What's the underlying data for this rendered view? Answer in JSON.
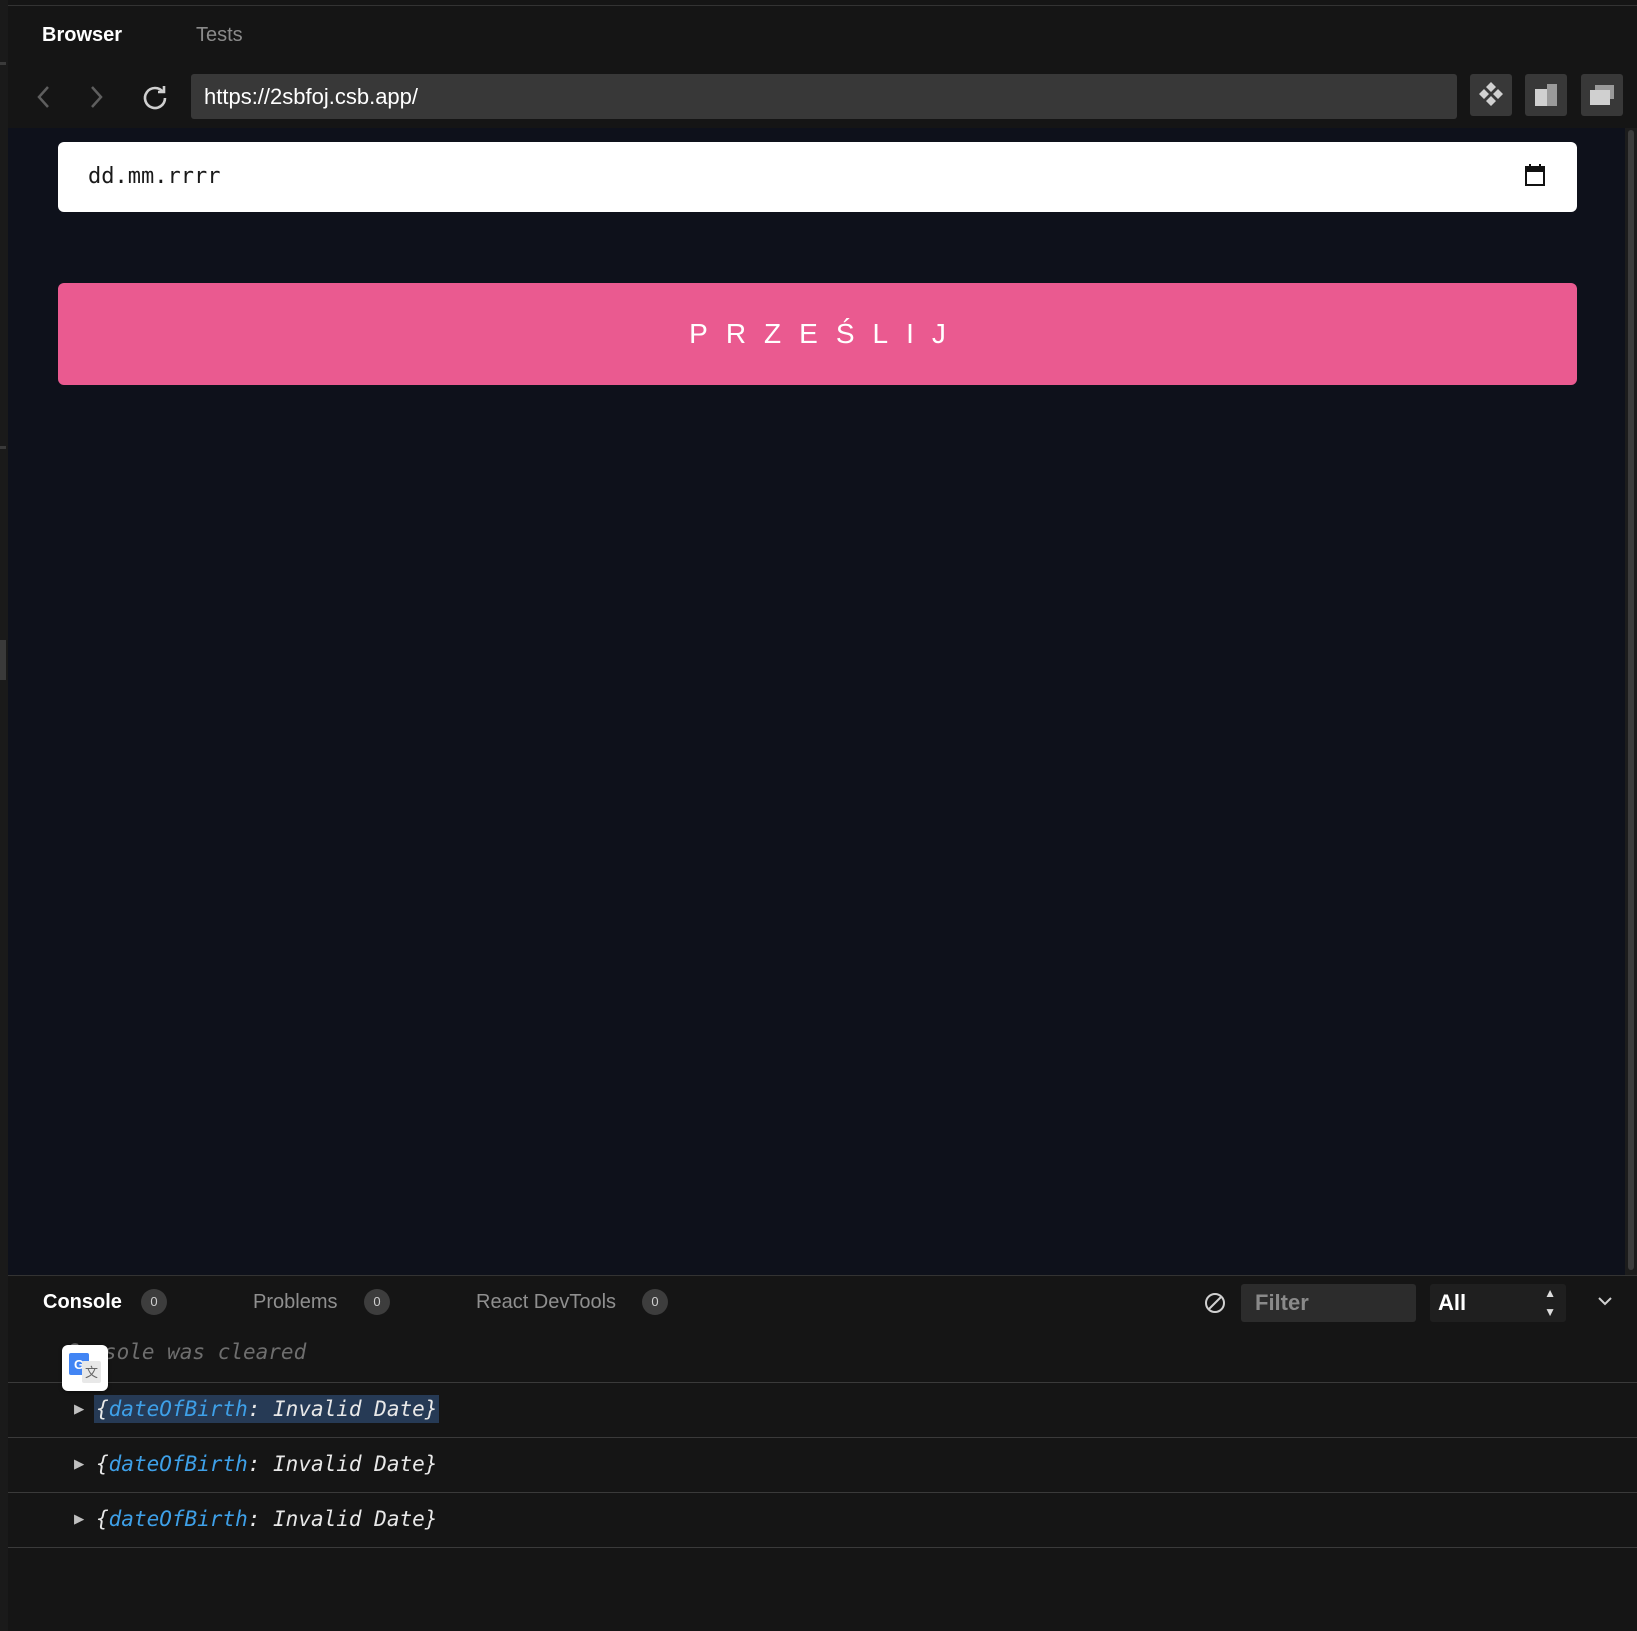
{
  "tabs": {
    "browser": "Browser",
    "tests": "Tests"
  },
  "navbar": {
    "url": "https://2sbfoj.csb.app/"
  },
  "form": {
    "date_value": "dd.mm.rrrr",
    "submit_label": "PRZEŚLIJ",
    "submit_color": "#ea5a90"
  },
  "console": {
    "tabs": [
      {
        "label": "Console",
        "count": "0"
      },
      {
        "label": "Problems",
        "count": "0"
      },
      {
        "label": "React DevTools",
        "count": "0"
      }
    ],
    "filter_placeholder": "Filter",
    "level": "All",
    "cleared_message": "Console was cleared",
    "entries": [
      {
        "key": "dateOfBirth",
        "value": "Invalid Date"
      },
      {
        "key": "dateOfBirth",
        "value": "Invalid Date"
      },
      {
        "key": "dateOfBirth",
        "value": "Invalid Date"
      }
    ]
  },
  "icons": {
    "back": "chevron-left-icon",
    "forward": "chevron-right-icon",
    "reload": "reload-icon",
    "calendar": "calendar-icon",
    "translate": "google-translate-icon"
  }
}
